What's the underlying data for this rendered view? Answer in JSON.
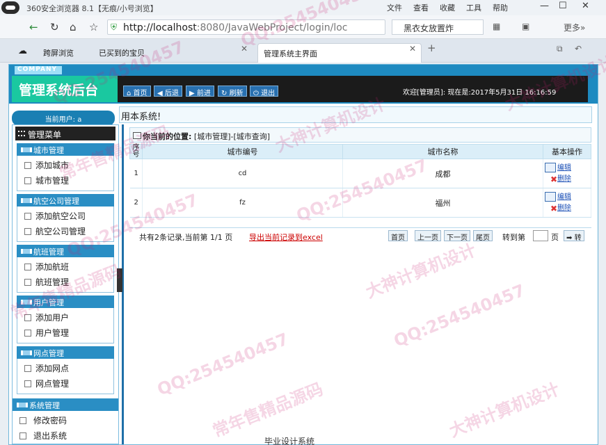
{
  "browser": {
    "title": "360安全浏览器 8.1【无痕/小号浏览】",
    "menu": [
      "文件",
      "查看",
      "收藏",
      "工具",
      "帮助"
    ],
    "url_host": "http://localhost",
    "url_rest": ":8080/JavaWebProject/login/loc",
    "search_text": "黑衣女放置炸",
    "more": "更多»",
    "tabs": [
      {
        "label": "跨屏浏览"
      },
      {
        "label": "已买到的宝贝"
      },
      {
        "label": "管理系统主界面"
      }
    ]
  },
  "header": {
    "company": "COMPANY",
    "title": "管理系统后台",
    "nav": [
      "首页",
      "后退",
      "前进",
      "刷新",
      "退出"
    ],
    "welcome": "欢迎[管理员]:    现在是:2017年5月31日 16:16:59"
  },
  "sidebar": {
    "current_user": "当前用户: a",
    "menu_title": "管理菜单",
    "groups": [
      {
        "title": "城市管理",
        "items": [
          "添加城市",
          "城市管理"
        ]
      },
      {
        "title": "航空公司管理",
        "items": [
          "添加航空公司",
          "航空公司管理"
        ]
      },
      {
        "title": "航班管理",
        "items": [
          "添加航班",
          "航班管理"
        ]
      },
      {
        "title": "用户管理",
        "items": [
          "添加用户",
          "用户管理"
        ]
      },
      {
        "title": "网点管理",
        "items": [
          "添加网点",
          "网点管理"
        ]
      },
      {
        "title": "系统管理",
        "items": [
          "修改密码",
          "退出系统"
        ]
      }
    ]
  },
  "main": {
    "notice": "用本系统!",
    "location_label": "你当前的位置:",
    "location_path": "[城市管理]-[城市查询]",
    "columns": [
      "序号",
      "城市编号",
      "城市名称",
      "基本操作"
    ],
    "rows": [
      {
        "idx": "1",
        "code": "cd",
        "name": "成都"
      },
      {
        "idx": "2",
        "code": "fz",
        "name": "福州"
      }
    ],
    "op_edit": "编辑",
    "op_delete": "删除",
    "pager": {
      "summary": "共有2条记录,当前第 1/1 页",
      "export": "导出当前记录到excel",
      "first": "首页",
      "prev": "上一页",
      "next": "下一页",
      "last": "尾页",
      "goto": "转到第",
      "page_unit": "页",
      "go": "转"
    }
  },
  "footer": "毕业设计系统",
  "watermarks": [
    "QQ:254540457",
    "大神计算机设计",
    "常年售精品源码"
  ]
}
